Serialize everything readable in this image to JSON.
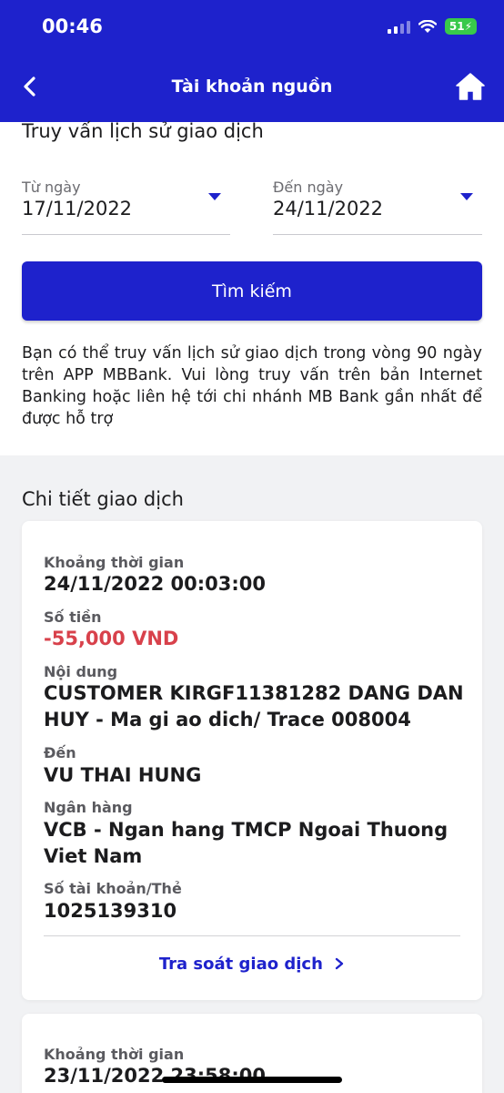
{
  "status_bar": {
    "time": "00:46",
    "battery": "51"
  },
  "nav": {
    "title": "Tài khoản nguồn"
  },
  "query": {
    "title": "Truy vấn lịch sử giao dịch",
    "from_label": "Từ ngày",
    "from_value": "17/11/2022",
    "to_label": "Đến ngày",
    "to_value": "24/11/2022",
    "search_label": "Tìm kiếm",
    "notice": "Bạn có thể truy vấn lịch sử giao dịch trong vòng 90 ngày trên APP MBBank. Vui lòng truy vấn trên bản Internet Banking hoặc liên hệ tới chi nhánh MB Bank gần nhất để được hỗ trợ"
  },
  "details": {
    "title": "Chi tiết giao dịch",
    "transactions": [
      {
        "time_label": "Khoảng thời gian",
        "time_value": "24/11/2022 00:03:00",
        "amount_label": "Số tiền",
        "amount_value": "-55,000 VND",
        "content_label": "Nội dung",
        "content_value": "CUSTOMER KIRGF11381282  DANG DAN HUY - Ma gi ao dich/ Trace 008004",
        "to_label": "Đến",
        "to_value": "VU THAI HUNG",
        "bank_label": "Ngân hàng",
        "bank_value": "VCB - Ngan hang TMCP Ngoai Thuong Viet Nam",
        "account_label": "Số tài khoản/Thẻ",
        "account_value": "1025139310",
        "trace_label": "Tra soát giao dịch"
      },
      {
        "time_label": "Khoảng thời gian",
        "time_value": "23/11/2022 23:58:00"
      }
    ]
  },
  "colors": {
    "brand": "#1e22cc",
    "negative": "#d8414b",
    "battery": "#38c94a"
  }
}
